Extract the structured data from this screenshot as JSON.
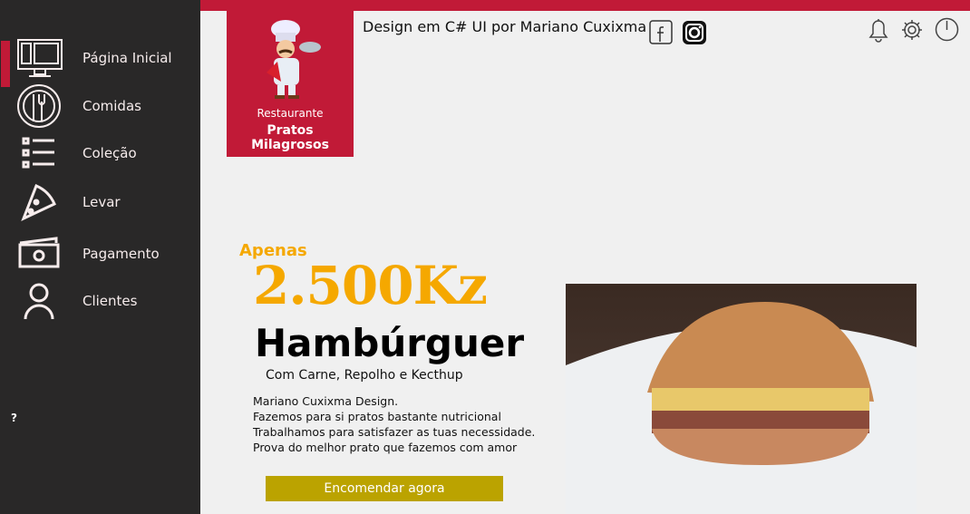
{
  "sidebar": {
    "items": [
      {
        "label": "Página Inicial",
        "icon": "monitor-icon",
        "active": true
      },
      {
        "label": "Comidas",
        "icon": "plate-cutlery-icon"
      },
      {
        "label": "Coleção",
        "icon": "list-icon"
      },
      {
        "label": "Levar",
        "icon": "pizza-icon"
      },
      {
        "label": "Pagamento",
        "icon": "money-icon"
      },
      {
        "label": "Clientes",
        "icon": "user-icon"
      }
    ],
    "help": "?"
  },
  "brand": {
    "subtitle": "Restaurante",
    "name": "Pratos Milagrosos"
  },
  "header": {
    "credit": "Design em C# UI por Mariano Cuxixma"
  },
  "promo": {
    "prefix": "Apenas",
    "price": "2.500Kz",
    "title": "Hambúrguer",
    "subtitle": "Com Carne, Repolho e Kecthup",
    "description": [
      "Mariano Cuxixma Design.",
      "Fazemos para si pratos bastante nutricional",
      "Trabalhamos para satisfazer as tuas necessidade.",
      "Prova do melhor prato que fazemos com amor"
    ],
    "button": "Encomendar agora"
  },
  "colors": {
    "accent": "#c11a37",
    "price": "#f5a800",
    "button": "#bba300",
    "sidebar": "#292828"
  }
}
